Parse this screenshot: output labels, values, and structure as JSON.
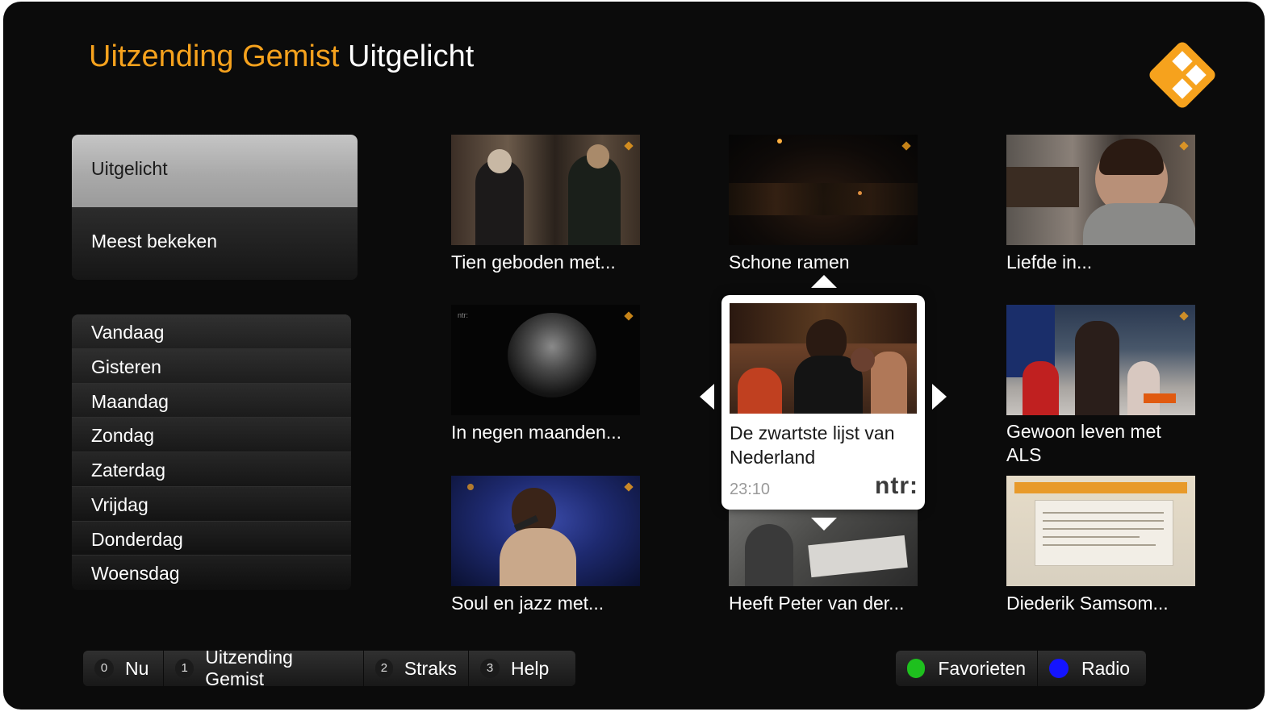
{
  "header": {
    "brand": "Uitzending Gemist",
    "section": "Uitgelicht"
  },
  "colors": {
    "accent": "#f6a21d",
    "green": "#1ec01e",
    "blue": "#1414ff"
  },
  "main_menu": [
    "Uitgelicht",
    "Meest bekeken"
  ],
  "days": [
    "Vandaag",
    "Gisteren",
    "Maandag",
    "Zondag",
    "Zaterdag",
    "Vrijdag",
    "Donderdag",
    "Woensdag"
  ],
  "tiles": [
    {
      "title": "Tien geboden met..."
    },
    {
      "title": "Schone ramen"
    },
    {
      "title": "Liefde in..."
    },
    {
      "title": "In negen maanden..."
    },
    {
      "title": "Gewoon leven met ALS"
    },
    {
      "title": "Soul en jazz met..."
    },
    {
      "title": "Heeft Peter van der..."
    },
    {
      "title": "Diederik Samsom..."
    }
  ],
  "featured": {
    "title": "De zwartste lijst van Nederland",
    "time": "23:10",
    "broadcaster": "ntr:"
  },
  "bottom_left": [
    {
      "key": "0",
      "label": "Nu"
    },
    {
      "key": "1",
      "label": "Uitzending Gemist"
    },
    {
      "key": "2",
      "label": "Straks"
    },
    {
      "key": "3",
      "label": "Help"
    }
  ],
  "bottom_right": [
    {
      "color": "green",
      "label": "Favorieten"
    },
    {
      "color": "blue",
      "label": "Radio"
    }
  ]
}
